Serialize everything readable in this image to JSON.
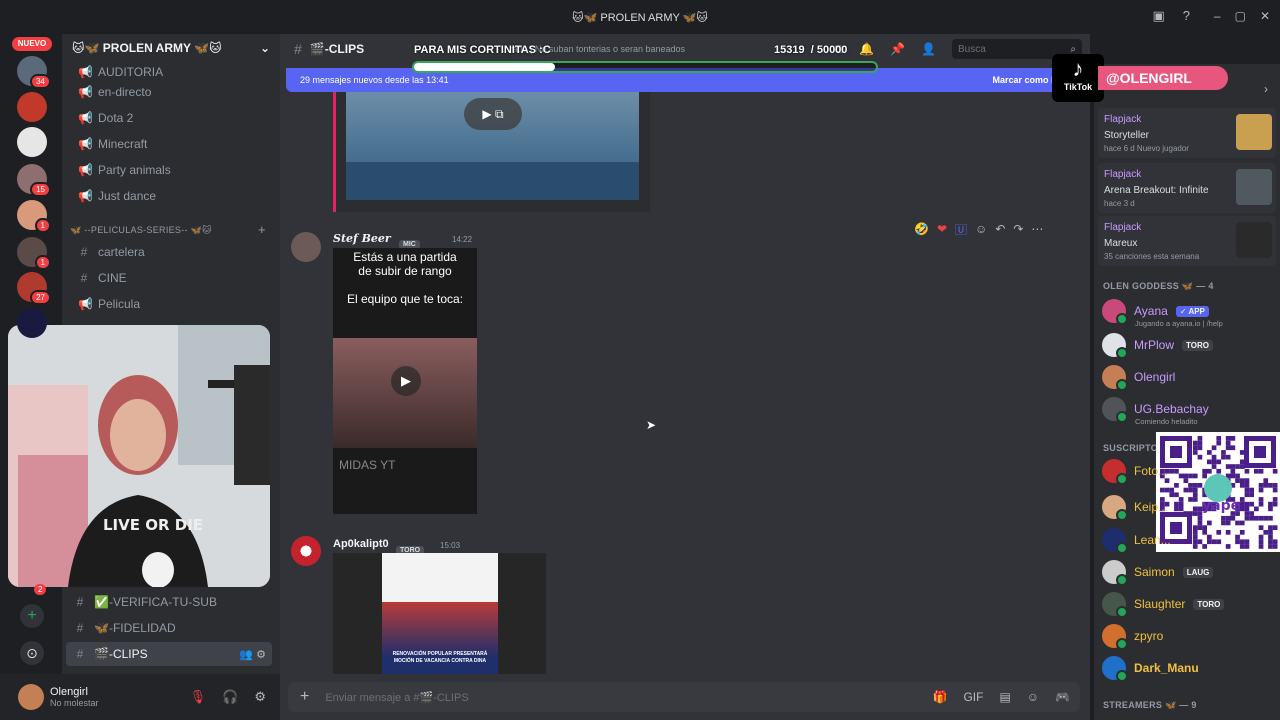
{
  "window": {
    "title": "🐱🦋 PROLEN ARMY 🦋🐱",
    "controls": [
      "–",
      "▢",
      "✕"
    ]
  },
  "rail": {
    "new_badge": "NUEVO",
    "servers": [
      {
        "color": "#5a6a7a",
        "badge": "34"
      },
      {
        "color": "#c0392b",
        "badge": ""
      },
      {
        "color": "#e6e6e6",
        "badge": ""
      },
      {
        "color": "#8e6e6e",
        "badge": "15"
      },
      {
        "color": "#d89a7a",
        "badge": "1"
      },
      {
        "color": "#5a4a48",
        "badge": "1"
      },
      {
        "color": "#b03a2e",
        "badge": "27"
      },
      {
        "color": "#1a1a40",
        "badge": ""
      }
    ],
    "add_icon": "+",
    "explore_icon": "⊙",
    "bottom_badge": "2"
  },
  "sidebar": {
    "server_name": "🐱🦋 PROLEN ARMY 🦋🐱",
    "channels_top": [
      {
        "icon": "megaphone-icon",
        "label": "AUDITORIA"
      },
      {
        "icon": "megaphone-icon",
        "label": "en-directo"
      },
      {
        "icon": "megaphone-icon",
        "label": "Dota 2"
      },
      {
        "icon": "megaphone-icon",
        "label": "Minecraft"
      },
      {
        "icon": "megaphone-icon",
        "label": "Party animals"
      },
      {
        "icon": "megaphone-icon",
        "label": "Just dance"
      }
    ],
    "category": "🦋 --PELICULAS-SERIES-- 🦋🐱",
    "channels_movies": [
      {
        "icon": "hash-icon",
        "label": "cartelera"
      },
      {
        "icon": "hash-icon",
        "label": "CINE"
      },
      {
        "icon": "megaphone-icon",
        "label": "Pelicula"
      }
    ],
    "channels_bottom": [
      {
        "label": "✅-VERIFICA-TU-SUB"
      },
      {
        "label": "🦋-FIDELIDAD"
      },
      {
        "label": "🎬-CLIPS"
      }
    ]
  },
  "user": {
    "name": "Olengirl",
    "status": "No molestar"
  },
  "header": {
    "channel": "🎬-CLIPS",
    "topic": "...rado | No suban tonterias o seran baneados",
    "search_placeholder": "Busca"
  },
  "goal": {
    "label": "PARA MIS CORTINITAS :C",
    "current": "15319",
    "target": "/ 50000",
    "progress": 0.306
  },
  "newbar": {
    "text": "29 mensajes nuevos desde las 13:41",
    "action": "Marcar como leído"
  },
  "messages": [
    {
      "author": "Stef Beer",
      "badge": "MIC",
      "time": "14:22",
      "caption_line1": "Estás a una partida",
      "caption_line2": "de subir de rango",
      "caption_line3": "El equipo que te toca:",
      "watermark": "MIDAS YT"
    },
    {
      "author": "Ap0kalipt0",
      "badge": "TORO",
      "time": "15:03",
      "caption": "RENOVACIÓN POPULAR PRESENTARÁ MOCIÓN DE VACANCIA CONTRA DINA"
    }
  ],
  "composer": {
    "placeholder": "Enviar mensaje a #🎬-CLIPS"
  },
  "overlay": {
    "tiktok_label": "TikTok",
    "handle": "@OLENGIRL"
  },
  "activities": [
    {
      "game": "Flapjack",
      "title": "Storyteller",
      "sub": "hace 6 d  Nuevo jugador"
    },
    {
      "game": "Flapjack",
      "title": "Arena Breakout: Infinite",
      "sub": "hace 3 d"
    },
    {
      "game": "Flapjack",
      "title": "Mareux",
      "sub": "35 canciones esta semana"
    }
  ],
  "members": {
    "section1": "OLEN GODDESS 🦋 — 4",
    "list1": [
      {
        "name": "Ayana",
        "badge": "✓ APP",
        "sub": "Jugando a ayana.io | /help",
        "color": "#c99bff"
      },
      {
        "name": "MrPlow",
        "badge": "TORO",
        "sub": "",
        "color": "#c99bff"
      },
      {
        "name": "Olengirl",
        "badge": "",
        "sub": "",
        "color": "#c99bff"
      },
      {
        "name": "UG.Bebachay",
        "badge": "",
        "sub": "Comiendo heladito",
        "color": "#c99bff"
      }
    ],
    "section2": "SUSCRIPTO...",
    "list2": [
      {
        "name": "Foto...",
        "badge": "",
        "color": "#f0c040"
      },
      {
        "name": "Keip...",
        "badge": "",
        "color": "#f0c040"
      },
      {
        "name": "Lean...",
        "badge": "",
        "color": "#f0c040"
      },
      {
        "name": "Saimon",
        "badge": "LAUG",
        "color": "#f0c040"
      },
      {
        "name": "Slaughter",
        "badge": "TORO",
        "color": "#f0c040"
      },
      {
        "name": "zpyro",
        "badge": "",
        "color": "#f0c040"
      },
      {
        "name": "Dark_Manu",
        "badge": "",
        "color": "#f0c040"
      }
    ],
    "section3": "STREAMERS 🦋 — 9"
  }
}
